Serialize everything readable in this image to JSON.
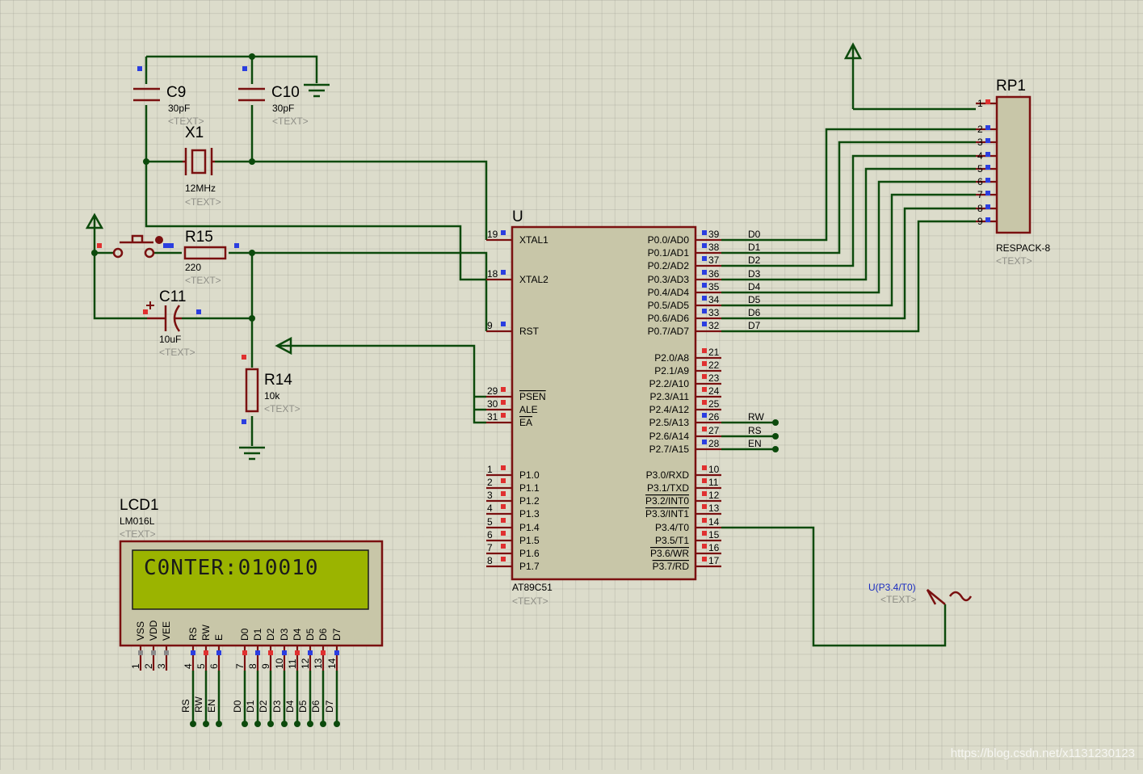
{
  "components": {
    "c9": {
      "ref": "C9",
      "value": "30pF",
      "text": "<TEXT>"
    },
    "c10": {
      "ref": "C10",
      "value": "30pF",
      "text": "<TEXT>"
    },
    "x1": {
      "ref": "X1",
      "value": "12MHz",
      "text": "<TEXT>"
    },
    "r15": {
      "ref": "R15",
      "value": "220",
      "text": "<TEXT>"
    },
    "c11": {
      "ref": "C11",
      "value": "10uF",
      "text": "<TEXT>"
    },
    "r14": {
      "ref": "R14",
      "value": "10k",
      "text": "<TEXT>"
    },
    "rp1": {
      "ref": "RP1",
      "value": "RESPACK-8",
      "text": "<TEXT>",
      "pins": [
        "1",
        "2",
        "3",
        "4",
        "5",
        "6",
        "7",
        "8",
        "9"
      ]
    },
    "lcd1": {
      "ref": "LCD1",
      "value": "LM016L",
      "text": "<TEXT>",
      "display": "C0NTER:010010"
    },
    "mcu": {
      "ref": "U",
      "value": "AT89C51",
      "text": "<TEXT>"
    },
    "gen": {
      "label": "U(P3.4/T0)",
      "text": "<TEXT>"
    }
  },
  "mcu_left": [
    {
      "num": "19",
      "name": "XTAL1"
    },
    {
      "num": "18",
      "name": "XTAL2"
    },
    {
      "num": "9",
      "name": "RST"
    },
    {
      "num": "29",
      "name": "PSEN"
    },
    {
      "num": "30",
      "name": "ALE"
    },
    {
      "num": "31",
      "name": "EA"
    },
    {
      "num": "1",
      "name": "P1.0"
    },
    {
      "num": "2",
      "name": "P1.1"
    },
    {
      "num": "3",
      "name": "P1.2"
    },
    {
      "num": "4",
      "name": "P1.3"
    },
    {
      "num": "5",
      "name": "P1.4"
    },
    {
      "num": "6",
      "name": "P1.5"
    },
    {
      "num": "7",
      "name": "P1.6"
    },
    {
      "num": "8",
      "name": "P1.7"
    }
  ],
  "mcu_right": [
    {
      "num": "39",
      "name": "P0.0/AD0",
      "net": "D0"
    },
    {
      "num": "38",
      "name": "P0.1/AD1",
      "net": "D1"
    },
    {
      "num": "37",
      "name": "P0.2/AD2",
      "net": "D2"
    },
    {
      "num": "36",
      "name": "P0.3/AD3",
      "net": "D3"
    },
    {
      "num": "35",
      "name": "P0.4/AD4",
      "net": "D4"
    },
    {
      "num": "34",
      "name": "P0.5/AD5",
      "net": "D5"
    },
    {
      "num": "33",
      "name": "P0.6/AD6",
      "net": "D6"
    },
    {
      "num": "32",
      "name": "P0.7/AD7",
      "net": "D7"
    },
    {
      "num": "21",
      "name": "P2.0/A8",
      "net": ""
    },
    {
      "num": "22",
      "name": "P2.1/A9",
      "net": ""
    },
    {
      "num": "23",
      "name": "P2.2/A10",
      "net": ""
    },
    {
      "num": "24",
      "name": "P2.3/A11",
      "net": ""
    },
    {
      "num": "25",
      "name": "P2.4/A12",
      "net": ""
    },
    {
      "num": "26",
      "name": "P2.5/A13",
      "net": "RW"
    },
    {
      "num": "27",
      "name": "P2.6/A14",
      "net": "RS"
    },
    {
      "num": "28",
      "name": "P2.7/A15",
      "net": "EN"
    },
    {
      "num": "10",
      "name": "P3.0/RXD",
      "net": ""
    },
    {
      "num": "11",
      "name": "P3.1/TXD",
      "net": ""
    },
    {
      "num": "12",
      "name": "P3.2/INT0",
      "net": ""
    },
    {
      "num": "13",
      "name": "P3.3/INT1",
      "net": ""
    },
    {
      "num": "14",
      "name": "P3.4/T0",
      "net": ""
    },
    {
      "num": "15",
      "name": "P3.5/T1",
      "net": ""
    },
    {
      "num": "16",
      "name": "P3.6/WR",
      "net": ""
    },
    {
      "num": "17",
      "name": "P3.7/RD",
      "net": ""
    }
  ],
  "lcd_pins": [
    {
      "num": "1",
      "name": "VSS",
      "net": ""
    },
    {
      "num": "2",
      "name": "VDD",
      "net": ""
    },
    {
      "num": "3",
      "name": "VEE",
      "net": ""
    },
    {
      "num": "4",
      "name": "RS",
      "net": "RS"
    },
    {
      "num": "5",
      "name": "RW",
      "net": "RW"
    },
    {
      "num": "6",
      "name": "E",
      "net": "EN"
    },
    {
      "num": "7",
      "name": "D0",
      "net": "D0"
    },
    {
      "num": "8",
      "name": "D1",
      "net": "D1"
    },
    {
      "num": "9",
      "name": "D2",
      "net": "D2"
    },
    {
      "num": "10",
      "name": "D3",
      "net": "D3"
    },
    {
      "num": "11",
      "name": "D4",
      "net": "D4"
    },
    {
      "num": "12",
      "name": "D5",
      "net": "D5"
    },
    {
      "num": "13",
      "name": "D6",
      "net": "D6"
    },
    {
      "num": "14",
      "name": "D7",
      "net": "D7"
    }
  ],
  "watermark": "https://blog.csdn.net/x1131230123",
  "colors": {
    "wire": "#0c4a0c",
    "body": "#7a1010",
    "fill": "#c8c6a8",
    "lcd_screen": "#9bb400"
  }
}
